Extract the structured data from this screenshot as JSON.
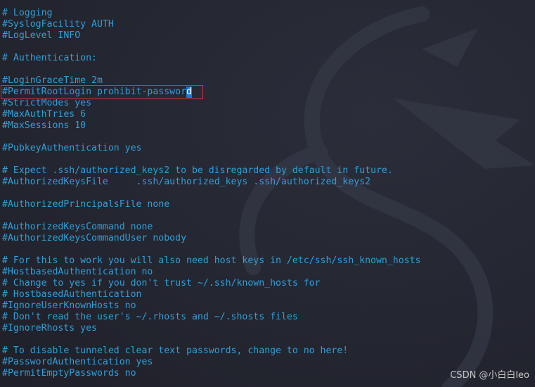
{
  "editor": {
    "lines": [
      "# Logging",
      "#SyslogFacility AUTH",
      "#LogLevel INFO",
      "",
      "# Authentication:",
      "",
      "#LoginGraceTime 2m",
      "",
      "#StrictModes yes",
      "#MaxAuthTries 6",
      "#MaxSessions 10",
      "",
      "#PubkeyAuthentication yes",
      "",
      "# Expect .ssh/authorized_keys2 to be disregarded by default in future.",
      "#AuthorizedKeysFile     .ssh/authorized_keys .ssh/authorized_keys2",
      "",
      "#AuthorizedPrincipalsFile none",
      "",
      "#AuthorizedKeysCommand none",
      "#AuthorizedKeysCommandUser nobody",
      "",
      "# For this to work you will also need host keys in /etc/ssh/ssh_known_hosts",
      "#HostbasedAuthentication no",
      "# Change to yes if you don't trust ~/.ssh/known_hosts for",
      "# HostbasedAuthentication",
      "#IgnoreUserKnownHosts no",
      "# Don't read the user's ~/.rhosts and ~/.shosts files",
      "#IgnoreRhosts yes",
      "",
      "# To disable tunneled clear text passwords, change to no here!",
      "#PasswordAuthentication yes",
      "#PermitEmptyPasswords no"
    ],
    "highlighted_line": {
      "text": "#PermitRootLogin prohibit-passwor",
      "cursor_char": "d"
    },
    "text_color": "#2f9fd8",
    "cursor_color": "#1a78d6",
    "highlight_box_color": "#d3363a"
  },
  "watermark": "CSDN @小白白leo"
}
